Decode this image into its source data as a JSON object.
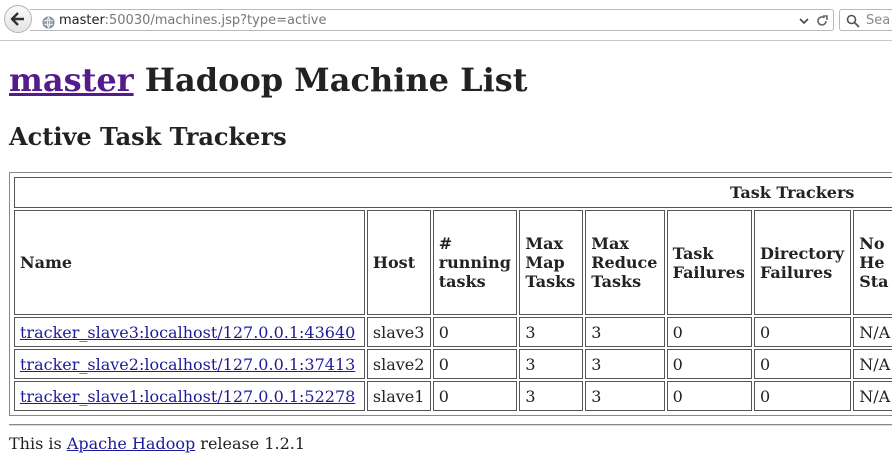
{
  "browser": {
    "url_host": "master",
    "url_rest": ":50030/machines.jsp?type=active",
    "search_placeholder": "Sea"
  },
  "page": {
    "title_link": "master",
    "title_rest": " Hadoop Machine List",
    "subtitle": "Active Task Trackers",
    "table_caption": "Task Trackers",
    "columns": [
      "Name",
      "Host",
      "# running tasks",
      "Max Map Tasks",
      "Max Reduce Tasks",
      "Task Failures",
      "Directory Failures",
      "Node Health Status"
    ],
    "column_lines": [
      [
        "Name"
      ],
      [
        "Host"
      ],
      [
        "#",
        "running",
        "tasks"
      ],
      [
        "Max",
        "Map",
        "Tasks"
      ],
      [
        "Max",
        "Reduce",
        "Tasks"
      ],
      [
        "Task",
        "Failures"
      ],
      [
        "Directory",
        "Failures"
      ],
      [
        "No",
        "He",
        "Sta"
      ]
    ],
    "rows": [
      {
        "name": "tracker_slave3:localhost/127.0.0.1:43640",
        "host": "slave3",
        "running": "0",
        "max_map": "3",
        "max_reduce": "3",
        "task_failures": "0",
        "dir_failures": "0",
        "health": "N/A"
      },
      {
        "name": "tracker_slave2:localhost/127.0.0.1:37413",
        "host": "slave2",
        "running": "0",
        "max_map": "3",
        "max_reduce": "3",
        "task_failures": "0",
        "dir_failures": "0",
        "health": "N/A"
      },
      {
        "name": "tracker_slave1:localhost/127.0.0.1:52278",
        "host": "slave1",
        "running": "0",
        "max_map": "3",
        "max_reduce": "3",
        "task_failures": "0",
        "dir_failures": "0",
        "health": "N/A"
      }
    ],
    "footer_prefix": "This is ",
    "footer_link": "Apache Hadoop",
    "footer_suffix": " release 1.2.1"
  }
}
